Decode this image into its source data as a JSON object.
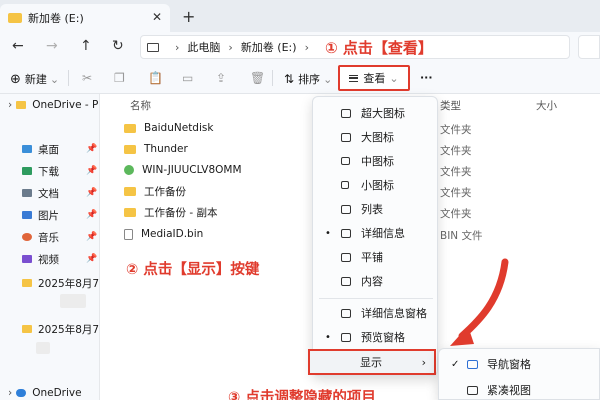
{
  "window": {
    "tab_title": "新加卷 (E:)",
    "tab_close": "✕",
    "new_tab": "+"
  },
  "address": {
    "crumbs": [
      "此电脑",
      "新加卷 (E:)"
    ],
    "separator": "›",
    "annotation_1": "① 点击【查看】"
  },
  "nav": {
    "back": "←",
    "forward": "→",
    "up": "↑",
    "refresh": "↻"
  },
  "toolbar": {
    "new_label": "新建",
    "sort_label": "排序",
    "view_label": "查看",
    "more_label": "···",
    "chevron": "⌄"
  },
  "sidebar": {
    "onedrive_label": "OneDrive - P",
    "quick": [
      {
        "label": "桌面",
        "color": "#3b8fd9"
      },
      {
        "label": "下载",
        "color": "#2e9b5f"
      },
      {
        "label": "文档",
        "color": "#6b7b8c"
      },
      {
        "label": "图片",
        "color": "#3a7bd5"
      },
      {
        "label": "音乐",
        "color": "#e0653a"
      },
      {
        "label": "视频",
        "color": "#7a4fd0"
      }
    ],
    "recent": [
      "2025年8月7E",
      "2025年8月7E"
    ],
    "onedrive_bottom": "OneDrive",
    "pin": "📌",
    "chevron": "›"
  },
  "files": {
    "col_name": "名称",
    "col_type": "类型",
    "col_size": "大小",
    "rows": [
      {
        "name": "BaiduNetdisk",
        "type": "文件夹",
        "kind": "folder"
      },
      {
        "name": "Thunder",
        "type": "文件夹",
        "kind": "folder"
      },
      {
        "name": "WIN-JIUUCLV8OMM",
        "type": "文件夹",
        "kind": "pc"
      },
      {
        "name": "工作备份",
        "type": "文件夹",
        "kind": "folder"
      },
      {
        "name": "工作备份 - 副本",
        "type": "文件夹",
        "kind": "folder"
      },
      {
        "name": "MediaID.bin",
        "type": "BIN 文件",
        "kind": "file"
      }
    ]
  },
  "menu": {
    "items": [
      "超大图标",
      "大图标",
      "中图标",
      "小图标",
      "列表",
      "详细信息",
      "平铺",
      "内容"
    ],
    "selected": "详细信息",
    "pane_items": [
      "详细信息窗格",
      "预览窗格"
    ],
    "pane_selected": "预览窗格",
    "show_label": "显示",
    "show_chevron": "›",
    "dot": "•"
  },
  "submenu": {
    "items": [
      "导航窗格",
      "紧凑视图"
    ],
    "checked": "导航窗格",
    "check": "✓"
  },
  "annotations": {
    "step2": "② 点击【显示】按键",
    "step3": "③ 点击调整隐藏的项目"
  },
  "colors": {
    "accent_red": "#e03b2d",
    "folder": "#f5c445"
  }
}
